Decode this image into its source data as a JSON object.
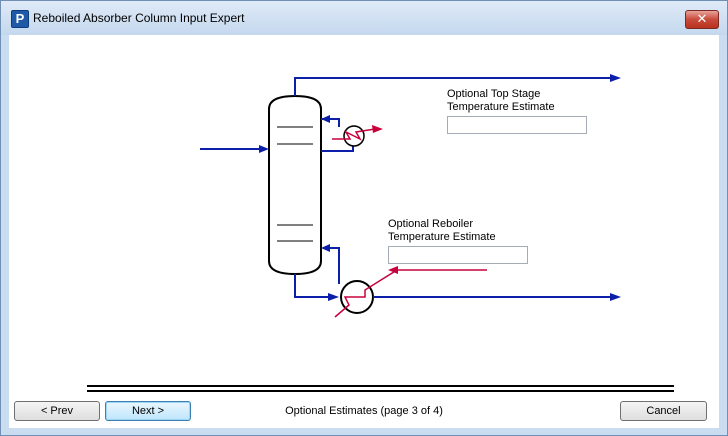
{
  "window": {
    "title": "Reboiled Absorber Column Input Expert",
    "app_icon_letter": "P",
    "close_glyph": "✕"
  },
  "fields": {
    "top_stage": {
      "label": "Optional Top Stage\nTemperature Estimate",
      "value": ""
    },
    "reboiler": {
      "label": "Optional Reboiler\nTemperature Estimate",
      "value": ""
    }
  },
  "footer": {
    "prev_label": "< Prev",
    "next_label": "Next >",
    "status": "Optional Estimates (page 3 of 4)",
    "cancel_label": "Cancel"
  },
  "colors": {
    "stream": "#0b1fa8",
    "utility": "#c8003c",
    "vessel": "#000000"
  }
}
